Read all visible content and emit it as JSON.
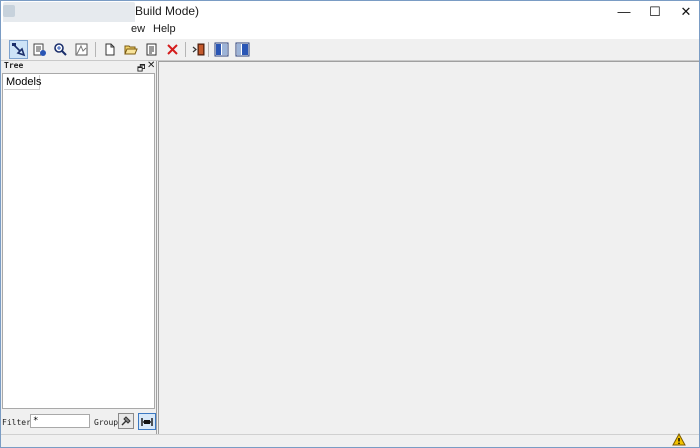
{
  "window": {
    "title": "Build Mode)",
    "minimize_glyph": "—",
    "maximize_glyph": "☐",
    "close_glyph": "✕"
  },
  "menu": {
    "items": [
      {
        "label": "ew"
      },
      {
        "label": "Help"
      }
    ]
  },
  "toolbar": {
    "buttons": [
      {
        "icon": "build-mode-icon",
        "active": true
      },
      {
        "icon": "simulate-icon",
        "active": false
      },
      {
        "icon": "inspect-icon",
        "active": false
      },
      {
        "icon": "diagram-icon",
        "active": false
      },
      {
        "icon": "new-file-icon",
        "active": false
      },
      {
        "icon": "open-folder-icon",
        "active": false
      },
      {
        "icon": "edit-document-icon",
        "active": false
      },
      {
        "icon": "delete-icon",
        "active": false
      },
      {
        "icon": "exit-icon",
        "active": false
      },
      {
        "icon": "panel-left-icon",
        "active": false
      },
      {
        "icon": "panel-right-icon",
        "active": false
      }
    ]
  },
  "tree": {
    "title": "Tree",
    "float_glyph": "🗗",
    "close_glyph": "✕",
    "tab_label": "Models",
    "filter_label": "Filter",
    "filter_value": "*",
    "group_label": "Group"
  },
  "colors": {
    "accent": "#7da2ce",
    "delete_red": "#d41c1c",
    "warning_yellow": "#f2c200"
  }
}
